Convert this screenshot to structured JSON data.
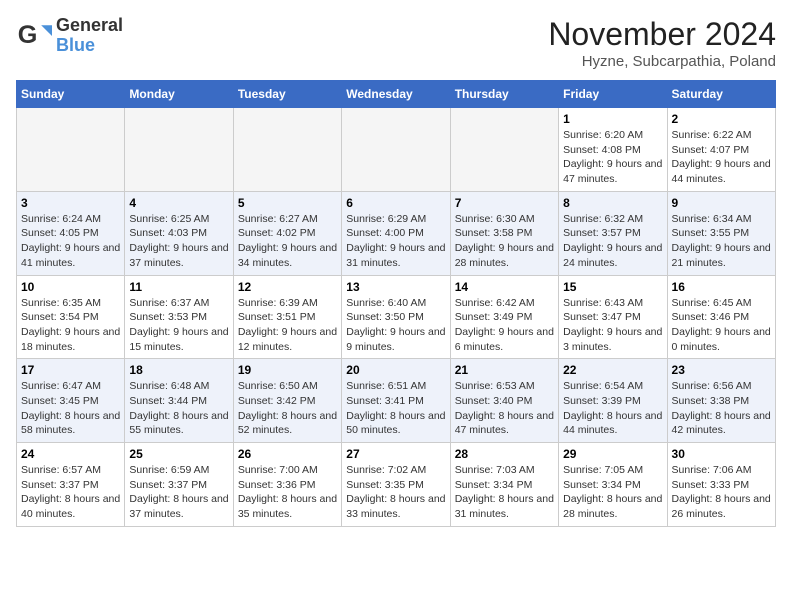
{
  "header": {
    "logo": {
      "text1": "General",
      "text2": "Blue"
    },
    "title": "November 2024",
    "subtitle": "Hyzne, Subcarpathia, Poland"
  },
  "days_of_week": [
    "Sunday",
    "Monday",
    "Tuesday",
    "Wednesday",
    "Thursday",
    "Friday",
    "Saturday"
  ],
  "weeks": [
    [
      {
        "day": "",
        "info": ""
      },
      {
        "day": "",
        "info": ""
      },
      {
        "day": "",
        "info": ""
      },
      {
        "day": "",
        "info": ""
      },
      {
        "day": "",
        "info": ""
      },
      {
        "day": "1",
        "info": "Sunrise: 6:20 AM\nSunset: 4:08 PM\nDaylight: 9 hours and 47 minutes."
      },
      {
        "day": "2",
        "info": "Sunrise: 6:22 AM\nSunset: 4:07 PM\nDaylight: 9 hours and 44 minutes."
      }
    ],
    [
      {
        "day": "3",
        "info": "Sunrise: 6:24 AM\nSunset: 4:05 PM\nDaylight: 9 hours and 41 minutes."
      },
      {
        "day": "4",
        "info": "Sunrise: 6:25 AM\nSunset: 4:03 PM\nDaylight: 9 hours and 37 minutes."
      },
      {
        "day": "5",
        "info": "Sunrise: 6:27 AM\nSunset: 4:02 PM\nDaylight: 9 hours and 34 minutes."
      },
      {
        "day": "6",
        "info": "Sunrise: 6:29 AM\nSunset: 4:00 PM\nDaylight: 9 hours and 31 minutes."
      },
      {
        "day": "7",
        "info": "Sunrise: 6:30 AM\nSunset: 3:58 PM\nDaylight: 9 hours and 28 minutes."
      },
      {
        "day": "8",
        "info": "Sunrise: 6:32 AM\nSunset: 3:57 PM\nDaylight: 9 hours and 24 minutes."
      },
      {
        "day": "9",
        "info": "Sunrise: 6:34 AM\nSunset: 3:55 PM\nDaylight: 9 hours and 21 minutes."
      }
    ],
    [
      {
        "day": "10",
        "info": "Sunrise: 6:35 AM\nSunset: 3:54 PM\nDaylight: 9 hours and 18 minutes."
      },
      {
        "day": "11",
        "info": "Sunrise: 6:37 AM\nSunset: 3:53 PM\nDaylight: 9 hours and 15 minutes."
      },
      {
        "day": "12",
        "info": "Sunrise: 6:39 AM\nSunset: 3:51 PM\nDaylight: 9 hours and 12 minutes."
      },
      {
        "day": "13",
        "info": "Sunrise: 6:40 AM\nSunset: 3:50 PM\nDaylight: 9 hours and 9 minutes."
      },
      {
        "day": "14",
        "info": "Sunrise: 6:42 AM\nSunset: 3:49 PM\nDaylight: 9 hours and 6 minutes."
      },
      {
        "day": "15",
        "info": "Sunrise: 6:43 AM\nSunset: 3:47 PM\nDaylight: 9 hours and 3 minutes."
      },
      {
        "day": "16",
        "info": "Sunrise: 6:45 AM\nSunset: 3:46 PM\nDaylight: 9 hours and 0 minutes."
      }
    ],
    [
      {
        "day": "17",
        "info": "Sunrise: 6:47 AM\nSunset: 3:45 PM\nDaylight: 8 hours and 58 minutes."
      },
      {
        "day": "18",
        "info": "Sunrise: 6:48 AM\nSunset: 3:44 PM\nDaylight: 8 hours and 55 minutes."
      },
      {
        "day": "19",
        "info": "Sunrise: 6:50 AM\nSunset: 3:42 PM\nDaylight: 8 hours and 52 minutes."
      },
      {
        "day": "20",
        "info": "Sunrise: 6:51 AM\nSunset: 3:41 PM\nDaylight: 8 hours and 50 minutes."
      },
      {
        "day": "21",
        "info": "Sunrise: 6:53 AM\nSunset: 3:40 PM\nDaylight: 8 hours and 47 minutes."
      },
      {
        "day": "22",
        "info": "Sunrise: 6:54 AM\nSunset: 3:39 PM\nDaylight: 8 hours and 44 minutes."
      },
      {
        "day": "23",
        "info": "Sunrise: 6:56 AM\nSunset: 3:38 PM\nDaylight: 8 hours and 42 minutes."
      }
    ],
    [
      {
        "day": "24",
        "info": "Sunrise: 6:57 AM\nSunset: 3:37 PM\nDaylight: 8 hours and 40 minutes."
      },
      {
        "day": "25",
        "info": "Sunrise: 6:59 AM\nSunset: 3:37 PM\nDaylight: 8 hours and 37 minutes."
      },
      {
        "day": "26",
        "info": "Sunrise: 7:00 AM\nSunset: 3:36 PM\nDaylight: 8 hours and 35 minutes."
      },
      {
        "day": "27",
        "info": "Sunrise: 7:02 AM\nSunset: 3:35 PM\nDaylight: 8 hours and 33 minutes."
      },
      {
        "day": "28",
        "info": "Sunrise: 7:03 AM\nSunset: 3:34 PM\nDaylight: 8 hours and 31 minutes."
      },
      {
        "day": "29",
        "info": "Sunrise: 7:05 AM\nSunset: 3:34 PM\nDaylight: 8 hours and 28 minutes."
      },
      {
        "day": "30",
        "info": "Sunrise: 7:06 AM\nSunset: 3:33 PM\nDaylight: 8 hours and 26 minutes."
      }
    ]
  ]
}
